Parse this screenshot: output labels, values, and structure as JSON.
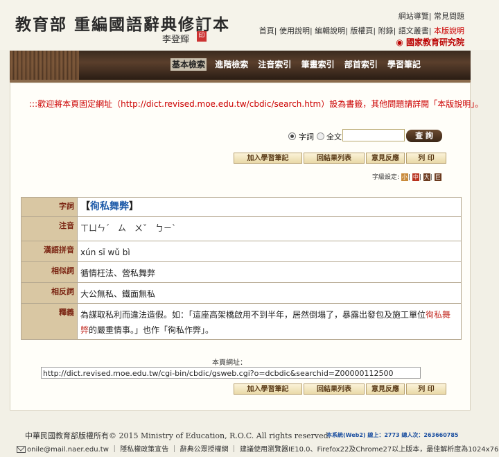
{
  "header": {
    "title": "教育部 重編國語辭典修訂本",
    "signature": "李登輝",
    "seal": "印",
    "links_top": [
      "網站導覽",
      "常見問題"
    ],
    "links_main": [
      "首頁",
      "使用說明",
      "編輯說明",
      "版權頁",
      "附錄",
      "語文叢書"
    ],
    "version_link": "本版說明",
    "institute": "國家教育研究院"
  },
  "nav": {
    "tabs": [
      "基本檢索",
      "進階檢索",
      "注音索引",
      "筆畫索引",
      "部首索引",
      "學習筆記"
    ],
    "active": "基本檢索"
  },
  "notice": ":::歡迎將本頁固定網址（http://dict.revised.moe.edu.tw/cbdic/search.htm）設為書籤，其他問題請詳閱「本版說明」。",
  "search": {
    "option_word": "字詞",
    "option_fulltext": "全文",
    "input_value": "",
    "button": "查 詢"
  },
  "actions": {
    "add_note": "加入學習筆記",
    "back_list": "回結果列表",
    "feedback": "意見反應",
    "print": "列 印"
  },
  "font_size": {
    "label": "字級設定:",
    "sizes": [
      "小",
      "中",
      "大",
      "巨"
    ],
    "colors": [
      "#c98a3a",
      "#b8321e",
      "#6b3a1e",
      "#6b3a1e"
    ]
  },
  "entry": {
    "word_open": "【",
    "word": "徇私舞弊",
    "word_close": "】",
    "rows": {
      "zhuyin_label": "注音",
      "zhuyin": "ㄒㄩㄣˊ　ㄙ　ㄨˇ　ㄅㄧˋ",
      "pinyin_label": "漢語拼音",
      "pinyin": "xún sī wǔ bì",
      "synonym_label": "相似詞",
      "synonym": "循情枉法、營私舞弊",
      "antonym_label": "相反詞",
      "antonym": "大公無私、鐵面無私",
      "def_label": "釋義",
      "word_label": "字詞",
      "def_before": "為謀取私利而違法造假。如：「這座高架橋啟用不到半年，居然倒塌了，暴露出發包及施工單位",
      "def_highlight": "徇私舞弊",
      "def_after": "的嚴重情事。」也作「徇私作弊」。"
    }
  },
  "page_url": {
    "label": "本頁網址：",
    "value": "http://dict.revised.moe.edu.tw/cgi-bin/cbdic/gsweb.cgi?o=dcbdic&searchid=Z00000112500"
  },
  "footer": {
    "copyright": "中華民國教育部版權所有© 2015 Ministry of Education, R.O.C. All rights reserved.",
    "stats": "本系統(Web2) 線上：2773 總人次：263660785",
    "email": "onile@mail.naer.edu.tw",
    "privacy": "隱私權政策宣告",
    "license": "辭典公眾授權網",
    "browser_note": "建議使用瀏覽器IE10.0、Firefox22及Chrome27以上版本，最佳解析度為1024x768。"
  }
}
